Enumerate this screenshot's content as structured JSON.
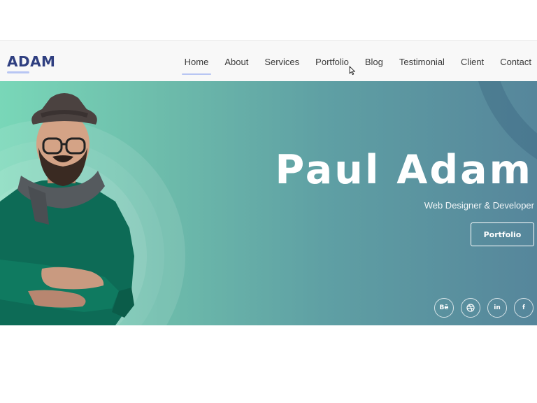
{
  "brand": {
    "logo": "ADAM",
    "accent": "#b8c6f3",
    "logo_color": "#2f3f80"
  },
  "nav": {
    "items": [
      {
        "label": "Home",
        "active": true
      },
      {
        "label": "About"
      },
      {
        "label": "Services"
      },
      {
        "label": "Portfolio"
      },
      {
        "label": "Blog"
      },
      {
        "label": "Testimonial"
      },
      {
        "label": "Client"
      },
      {
        "label": "Contact"
      }
    ]
  },
  "hero": {
    "name": "Paul Adam",
    "role": "Web Designer & Developer",
    "button_label": "Portfolio",
    "gradient": [
      "#79d7b8",
      "#56869b"
    ]
  },
  "social": {
    "items": [
      {
        "icon": "behance-icon",
        "glyph": "Bē"
      },
      {
        "icon": "dribbble-icon",
        "glyph": ""
      },
      {
        "icon": "linkedin-icon",
        "glyph": "in"
      },
      {
        "icon": "facebook-icon",
        "glyph": "f"
      }
    ]
  }
}
